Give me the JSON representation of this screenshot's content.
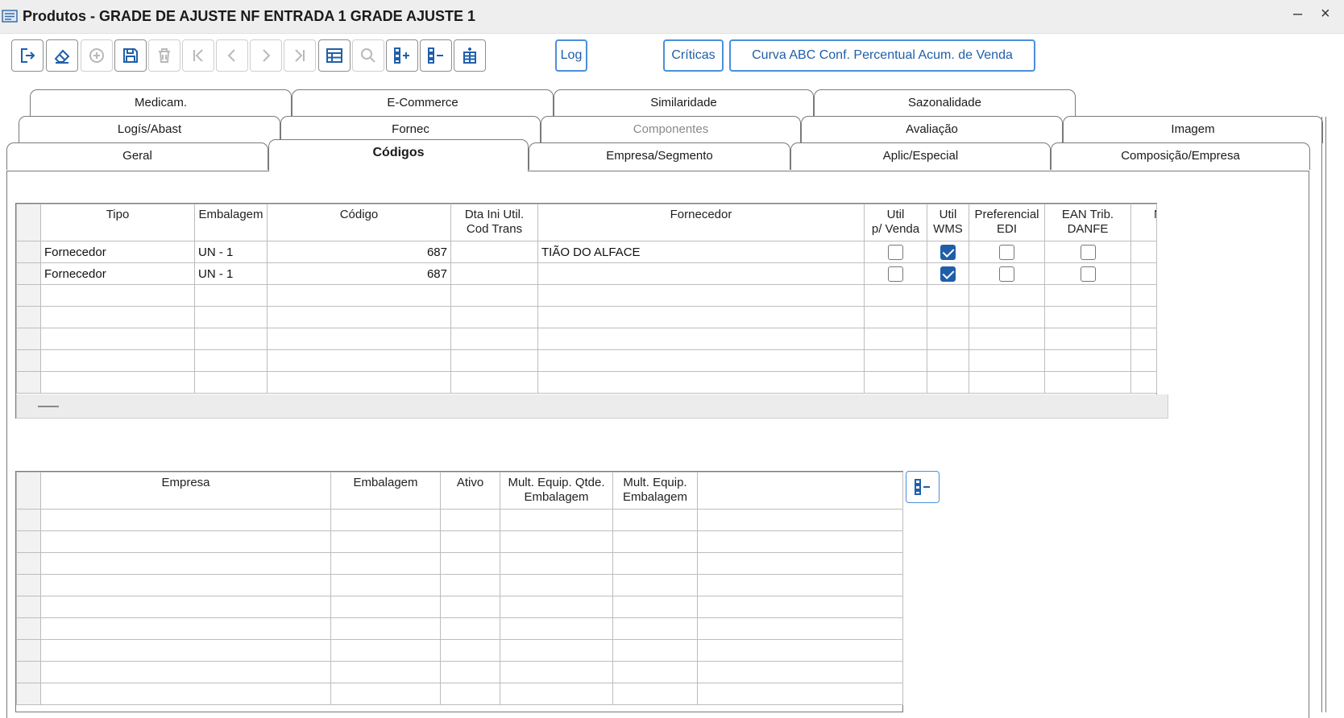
{
  "window": {
    "title": "Produtos - GRADE DE AJUSTE NF ENTRADA 1 GRADE AJUSTE 1",
    "minimize": "–",
    "close": "×"
  },
  "toolbar": {
    "icons": [
      "exit-icon",
      "eraser-icon",
      "add-circle-icon",
      "save-icon",
      "trash-icon",
      "first-record-icon",
      "previous-record-icon",
      "next-record-icon",
      "last-record-icon",
      "grid-view-icon",
      "search-icon",
      "add-row-icon",
      "remove-row-icon",
      "insert-row-icon"
    ],
    "log_label": "Log",
    "criticas_label": "Críticas",
    "curva_label": "Curva ABC Conf. Percentual Acum. de Venda"
  },
  "tabs": {
    "row1": [
      "Medicam.",
      "E-Commerce",
      "Similaridade",
      "Sazonalidade"
    ],
    "row2": [
      "Logís/Abast",
      "Fornec",
      "Componentes",
      "Avaliação",
      "Imagem"
    ],
    "row3": [
      "Geral",
      "Códigos",
      "Empresa/Segmento",
      "Aplic/Especial",
      "Composição/Empresa"
    ],
    "active": "Códigos",
    "disabled": [
      "Componentes"
    ]
  },
  "codes_grid": {
    "headers": {
      "tipo": "Tipo",
      "embalagem": "Embalagem",
      "codigo": "Código",
      "dta_ini_1": "Dta Ini Util.",
      "dta_ini_2": "Cod Trans",
      "fornecedor": "Fornecedor",
      "util_venda_1": "Util",
      "util_venda_2": "p/ Venda",
      "util_wms_1": "Util",
      "util_wms_2": "WMS",
      "pref_edi_1": "Preferencial",
      "pref_edi_2": "EDI",
      "ean_1": "EAN Trib.",
      "ean_2": "DANFE",
      "next": "N"
    },
    "rows": [
      {
        "tipo": "Fornecedor",
        "embalagem": "UN - 1",
        "codigo": "687",
        "dta_ini": "",
        "fornecedor": "TIÃO DO ALFACE",
        "util_venda": false,
        "util_wms": true,
        "pref_edi": false,
        "ean_danfe": false
      },
      {
        "tipo": "Fornecedor",
        "embalagem": "UN - 1",
        "codigo": "687",
        "dta_ini": "",
        "fornecedor": "",
        "util_venda": false,
        "util_wms": true,
        "pref_edi": false,
        "ean_danfe": false
      }
    ]
  },
  "company_grid": {
    "headers": {
      "empresa": "Empresa",
      "embalagem": "Embalagem",
      "ativo": "Ativo",
      "mult_qtde_1": "Mult. Equip. Qtde.",
      "mult_qtde_2": "Embalagem",
      "mult_emb_1": "Mult. Equip.",
      "mult_emb_2": "Embalagem"
    }
  },
  "colors": {
    "accent": "#1f5fa8",
    "button_border": "#4a90d9",
    "titlebar": "#eeeeee"
  }
}
